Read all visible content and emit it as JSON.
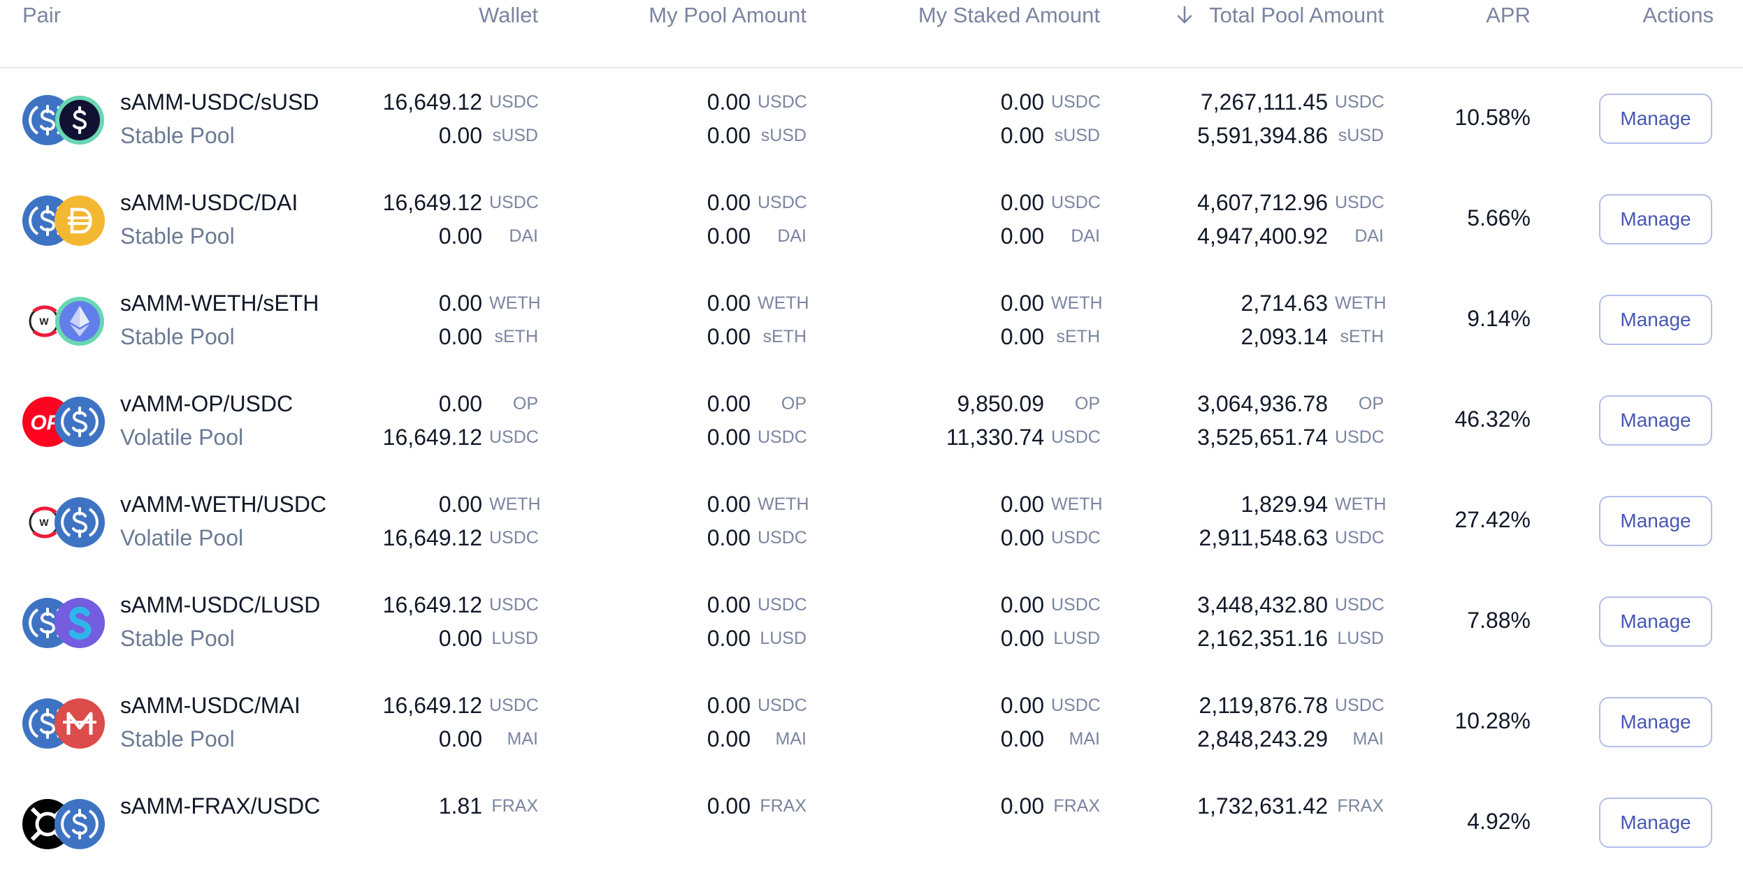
{
  "columns": {
    "pair": "Pair",
    "wallet": "Wallet",
    "pool": "My Pool Amount",
    "staked": "My Staked Amount",
    "total": "Total Pool Amount",
    "apr": "APR",
    "actions": "Actions"
  },
  "sort_icon": "arrow-down-icon",
  "colors": {
    "usdc": "#3e73c4",
    "susd": "#111133",
    "dai": "#f4b731",
    "weth": "#ec1c3b",
    "seth": "#627eea",
    "op": "#ff0420",
    "lusd": "#745ddf",
    "mai": "#db4c4a",
    "frax": "#000000",
    "button_text": "#4757b4"
  },
  "rows": [
    {
      "name": "sAMM-USDC/sUSD",
      "type": "Stable Pool",
      "icons": [
        "usdc-icon",
        "susd-icon"
      ],
      "wallet": [
        {
          "v": "16,649.12",
          "s": "USDC"
        },
        {
          "v": "0.00",
          "s": "sUSD"
        }
      ],
      "pool": [
        {
          "v": "0.00",
          "s": "USDC"
        },
        {
          "v": "0.00",
          "s": "sUSD"
        }
      ],
      "staked": [
        {
          "v": "0.00",
          "s": "USDC"
        },
        {
          "v": "0.00",
          "s": "sUSD"
        }
      ],
      "total": [
        {
          "v": "7,267,111.45",
          "s": "USDC"
        },
        {
          "v": "5,591,394.86",
          "s": "sUSD"
        }
      ],
      "apr": "10.58%",
      "action": "Manage"
    },
    {
      "name": "sAMM-USDC/DAI",
      "type": "Stable Pool",
      "icons": [
        "usdc-icon",
        "dai-icon"
      ],
      "wallet": [
        {
          "v": "16,649.12",
          "s": "USDC"
        },
        {
          "v": "0.00",
          "s": "DAI"
        }
      ],
      "pool": [
        {
          "v": "0.00",
          "s": "USDC"
        },
        {
          "v": "0.00",
          "s": "DAI"
        }
      ],
      "staked": [
        {
          "v": "0.00",
          "s": "USDC"
        },
        {
          "v": "0.00",
          "s": "DAI"
        }
      ],
      "total": [
        {
          "v": "4,607,712.96",
          "s": "USDC"
        },
        {
          "v": "4,947,400.92",
          "s": "DAI"
        }
      ],
      "apr": "5.66%",
      "action": "Manage"
    },
    {
      "name": "sAMM-WETH/sETH",
      "type": "Stable Pool",
      "icons": [
        "weth-icon",
        "seth-icon"
      ],
      "wallet": [
        {
          "v": "0.00",
          "s": "WETH"
        },
        {
          "v": "0.00",
          "s": "sETH"
        }
      ],
      "pool": [
        {
          "v": "0.00",
          "s": "WETH"
        },
        {
          "v": "0.00",
          "s": "sETH"
        }
      ],
      "staked": [
        {
          "v": "0.00",
          "s": "WETH"
        },
        {
          "v": "0.00",
          "s": "sETH"
        }
      ],
      "total": [
        {
          "v": "2,714.63",
          "s": "WETH"
        },
        {
          "v": "2,093.14",
          "s": "sETH"
        }
      ],
      "apr": "9.14%",
      "action": "Manage"
    },
    {
      "name": "vAMM-OP/USDC",
      "type": "Volatile Pool",
      "icons": [
        "op-icon",
        "usdc-icon"
      ],
      "wallet": [
        {
          "v": "0.00",
          "s": "OP"
        },
        {
          "v": "16,649.12",
          "s": "USDC"
        }
      ],
      "pool": [
        {
          "v": "0.00",
          "s": "OP"
        },
        {
          "v": "0.00",
          "s": "USDC"
        }
      ],
      "staked": [
        {
          "v": "9,850.09",
          "s": "OP"
        },
        {
          "v": "11,330.74",
          "s": "USDC"
        }
      ],
      "total": [
        {
          "v": "3,064,936.78",
          "s": "OP"
        },
        {
          "v": "3,525,651.74",
          "s": "USDC"
        }
      ],
      "apr": "46.32%",
      "action": "Manage"
    },
    {
      "name": "vAMM-WETH/USDC",
      "type": "Volatile Pool",
      "icons": [
        "weth-icon",
        "usdc-icon"
      ],
      "wallet": [
        {
          "v": "0.00",
          "s": "WETH"
        },
        {
          "v": "16,649.12",
          "s": "USDC"
        }
      ],
      "pool": [
        {
          "v": "0.00",
          "s": "WETH"
        },
        {
          "v": "0.00",
          "s": "USDC"
        }
      ],
      "staked": [
        {
          "v": "0.00",
          "s": "WETH"
        },
        {
          "v": "0.00",
          "s": "USDC"
        }
      ],
      "total": [
        {
          "v": "1,829.94",
          "s": "WETH"
        },
        {
          "v": "2,911,548.63",
          "s": "USDC"
        }
      ],
      "apr": "27.42%",
      "action": "Manage"
    },
    {
      "name": "sAMM-USDC/LUSD",
      "type": "Stable Pool",
      "icons": [
        "usdc-icon",
        "lusd-icon"
      ],
      "wallet": [
        {
          "v": "16,649.12",
          "s": "USDC"
        },
        {
          "v": "0.00",
          "s": "LUSD"
        }
      ],
      "pool": [
        {
          "v": "0.00",
          "s": "USDC"
        },
        {
          "v": "0.00",
          "s": "LUSD"
        }
      ],
      "staked": [
        {
          "v": "0.00",
          "s": "USDC"
        },
        {
          "v": "0.00",
          "s": "LUSD"
        }
      ],
      "total": [
        {
          "v": "3,448,432.80",
          "s": "USDC"
        },
        {
          "v": "2,162,351.16",
          "s": "LUSD"
        }
      ],
      "apr": "7.88%",
      "action": "Manage"
    },
    {
      "name": "sAMM-USDC/MAI",
      "type": "Stable Pool",
      "icons": [
        "usdc-icon",
        "mai-icon"
      ],
      "wallet": [
        {
          "v": "16,649.12",
          "s": "USDC"
        },
        {
          "v": "0.00",
          "s": "MAI"
        }
      ],
      "pool": [
        {
          "v": "0.00",
          "s": "USDC"
        },
        {
          "v": "0.00",
          "s": "MAI"
        }
      ],
      "staked": [
        {
          "v": "0.00",
          "s": "USDC"
        },
        {
          "v": "0.00",
          "s": "MAI"
        }
      ],
      "total": [
        {
          "v": "2,119,876.78",
          "s": "USDC"
        },
        {
          "v": "2,848,243.29",
          "s": "MAI"
        }
      ],
      "apr": "10.28%",
      "action": "Manage"
    },
    {
      "name": "sAMM-FRAX/USDC",
      "type": "",
      "icons": [
        "frax-icon",
        "usdc-icon"
      ],
      "wallet": [
        {
          "v": "1.81",
          "s": "FRAX"
        }
      ],
      "pool": [
        {
          "v": "0.00",
          "s": "FRAX"
        }
      ],
      "staked": [
        {
          "v": "0.00",
          "s": "FRAX"
        }
      ],
      "total": [
        {
          "v": "1,732,631.42",
          "s": "FRAX"
        }
      ],
      "apr": "4.92%",
      "action": "Manage"
    }
  ]
}
